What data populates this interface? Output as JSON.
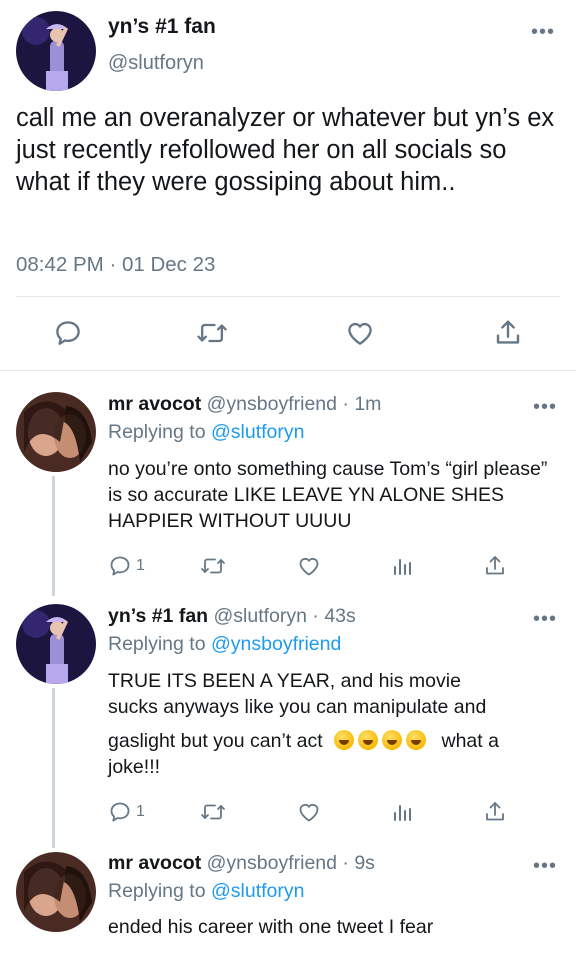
{
  "main_tweet": {
    "display_name": "yn’s #1 fan",
    "handle": "@slutforyn",
    "text": "call me an overanalyzer or whatever but yn’s ex just recently refollowed her on all socials so what if they were gossiping about him..",
    "timestamp": "08:42 PM · 01 Dec 23",
    "actions": [
      "reply-icon",
      "retweet-icon",
      "like-icon",
      "share-icon"
    ]
  },
  "replies": [
    {
      "display_name": "mr avocot",
      "handle": "@ynsboyfriend",
      "time": "· 1m",
      "replying_prefix": "Replying to",
      "replying_to": "@slutforyn",
      "text": "no you’re onto something cause Tom’s “girl please” is so accurate LIKE LEAVE YN ALONE SHES HAPPIER WITHOUT UUUU",
      "reply_count": "1"
    },
    {
      "display_name": "yn’s #1 fan",
      "handle": "@slutforyn",
      "time": "· 43s",
      "replying_prefix": "Replying to",
      "replying_to": "@ynsboyfriend",
      "text_line1": "TRUE ITS BEEN A YEAR, and his movie",
      "text_line2": "sucks anyways like you can manipulate and",
      "text_line3_pre": "gaslight but you can’t act",
      "text_line3_post": "what a",
      "text_line4": "joke!!!",
      "emoji": [
        "rofl",
        "rofl",
        "rofl",
        "rofl"
      ],
      "reply_count": "1"
    },
    {
      "display_name": "mr avocot",
      "handle": "@ynsboyfriend",
      "time": "· 9s",
      "replying_prefix": "Replying to",
      "replying_to": "@slutforyn",
      "text": "ended his career with one tweet I fear"
    }
  ],
  "colors": {
    "link": "#1d9bf0",
    "muted": "#657786",
    "divider": "#e1e8ed",
    "thread_line": "#ccd6dd"
  }
}
